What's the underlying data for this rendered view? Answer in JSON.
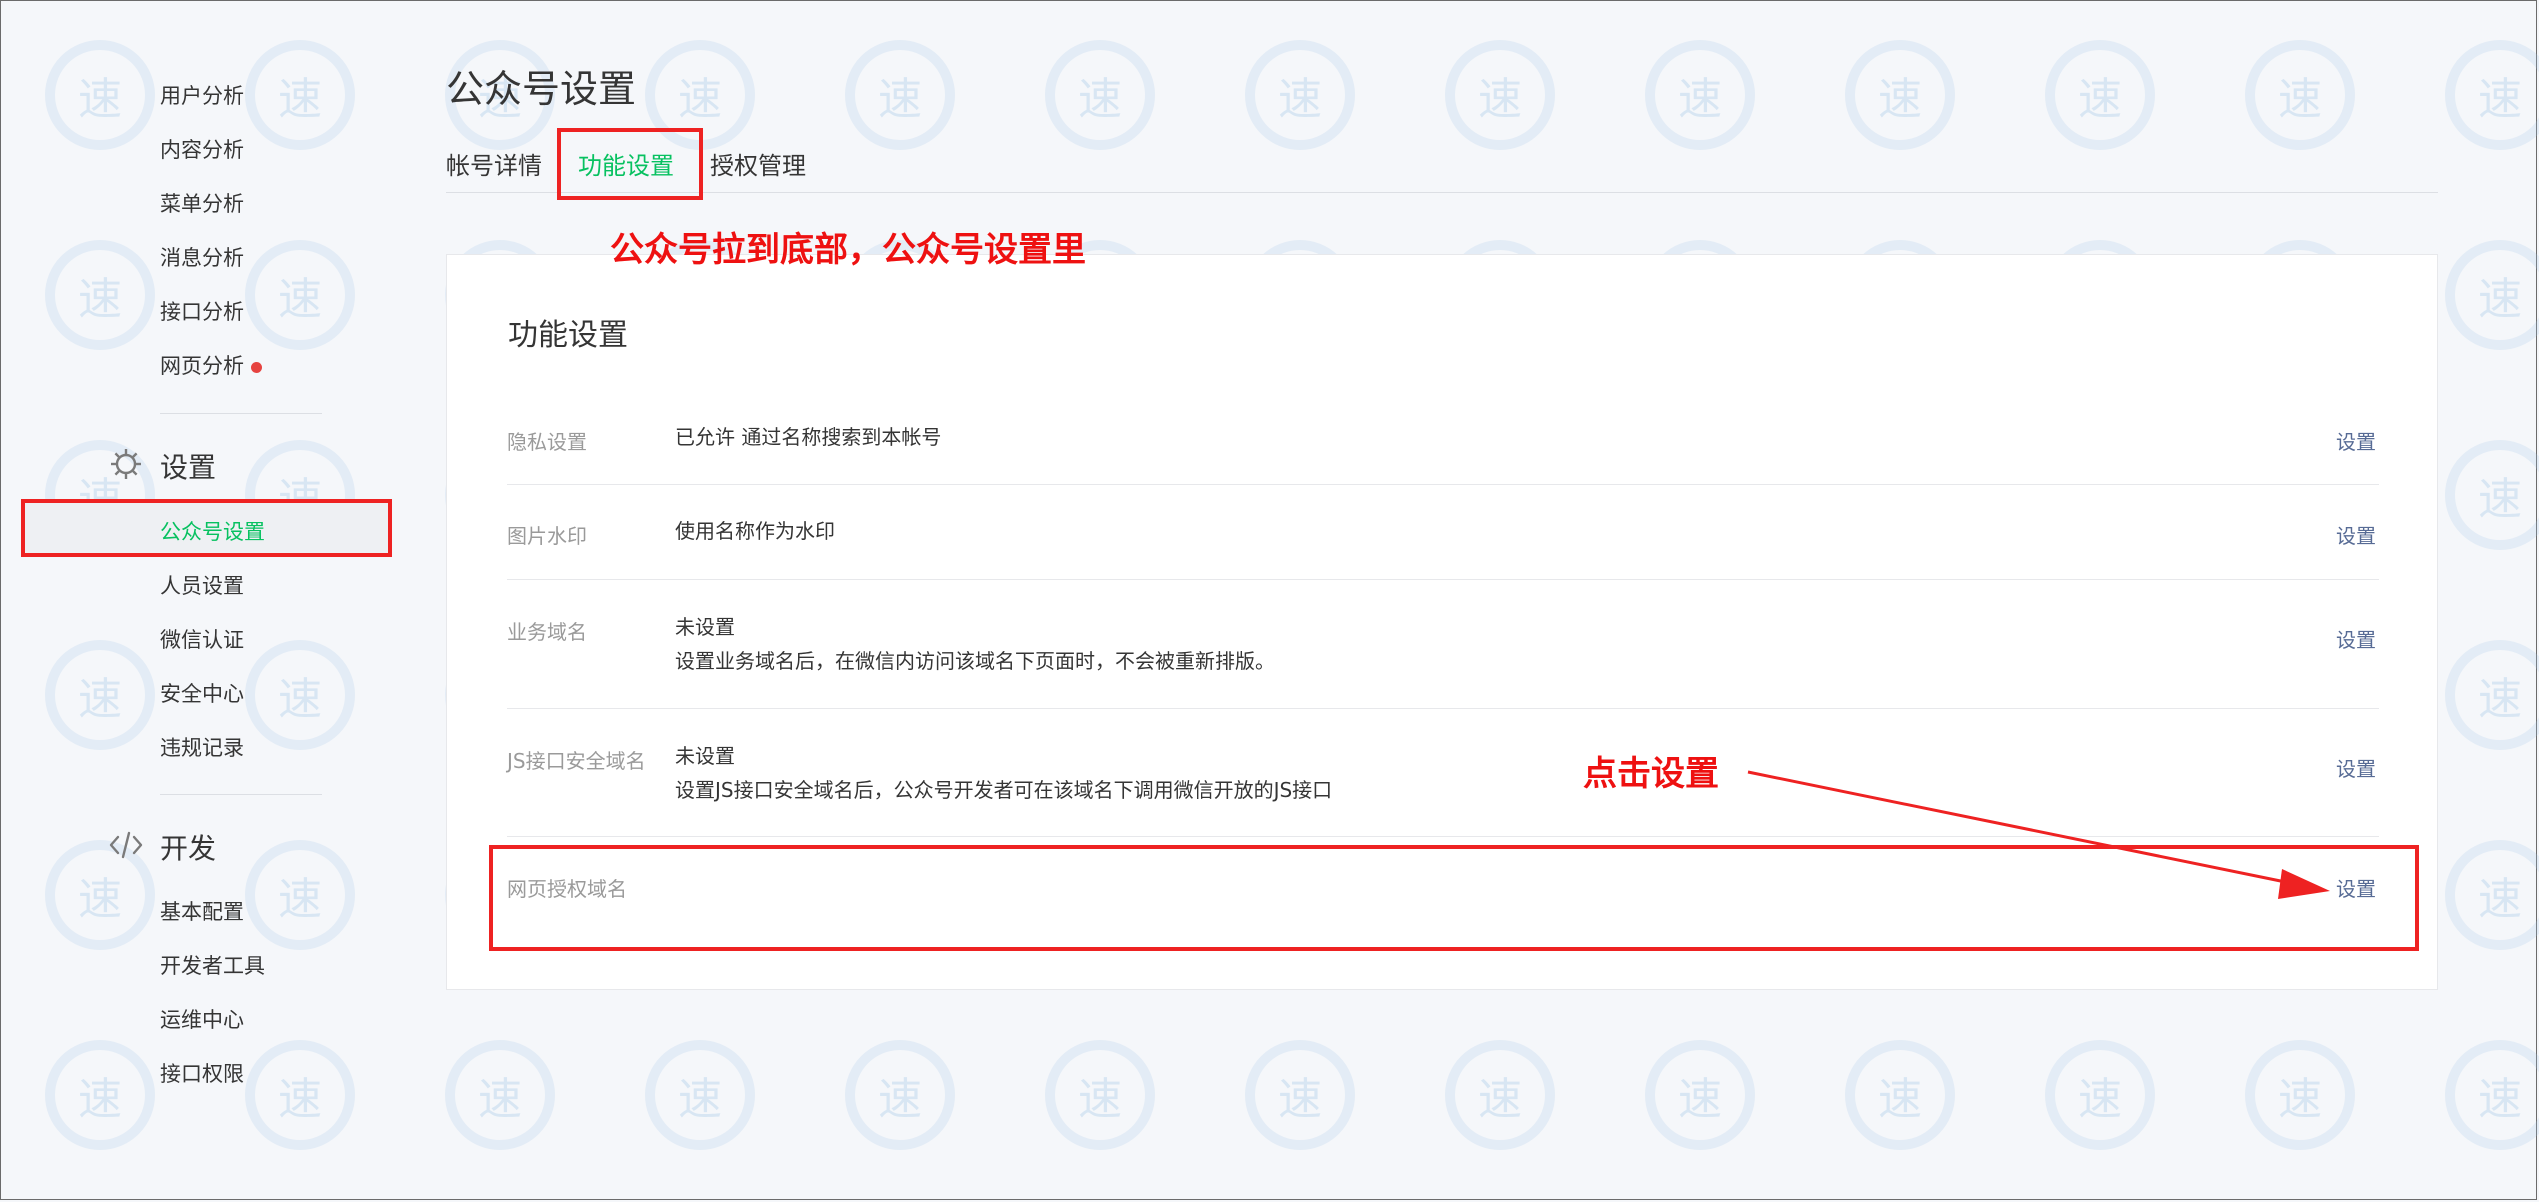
{
  "sidebar": {
    "analytics_items": [
      {
        "label": "用户分析"
      },
      {
        "label": "内容分析"
      },
      {
        "label": "菜单分析"
      },
      {
        "label": "消息分析"
      },
      {
        "label": "接口分析"
      },
      {
        "label": "网页分析",
        "has_dot": true
      }
    ],
    "settings": {
      "title": "设置",
      "items": [
        {
          "label": "公众号设置",
          "active": true
        },
        {
          "label": "人员设置"
        },
        {
          "label": "微信认证"
        },
        {
          "label": "安全中心"
        },
        {
          "label": "违规记录"
        }
      ]
    },
    "dev": {
      "title": "开发",
      "items": [
        {
          "label": "基本配置"
        },
        {
          "label": "开发者工具"
        },
        {
          "label": "运维中心"
        },
        {
          "label": "接口权限"
        }
      ]
    }
  },
  "main": {
    "title": "公众号设置",
    "tabs": [
      {
        "label": "帐号详情"
      },
      {
        "label": "功能设置",
        "active": true
      },
      {
        "label": "授权管理"
      }
    ],
    "panel": {
      "title": "功能设置",
      "action_label": "设置",
      "rows": [
        {
          "label": "隐私设置",
          "value_lines": [
            "已允许 通过名称搜索到本帐号"
          ]
        },
        {
          "label": "图片水印",
          "value_lines": [
            "使用名称作为水印"
          ]
        },
        {
          "label": "业务域名",
          "value_lines": [
            "未设置",
            "设置业务域名后，在微信内访问该域名下页面时，不会被重新排版。"
          ]
        },
        {
          "label": "JS接口安全域名",
          "value_lines": [
            "未设置",
            "设置JS接口安全域名后，公众号开发者可在该域名下调用微信开放的JS接口"
          ]
        },
        {
          "label": "网页授权域名",
          "value_lines": []
        }
      ]
    }
  },
  "annotations": {
    "tip_bottom": "公众号拉到底部，公众号设置里",
    "tip_click": "点击设置",
    "color": "#ee1111"
  },
  "watermark": {
    "glyph": "速"
  },
  "colors": {
    "accent": "#07c160",
    "link": "#576b95",
    "dot": "#e64340"
  }
}
